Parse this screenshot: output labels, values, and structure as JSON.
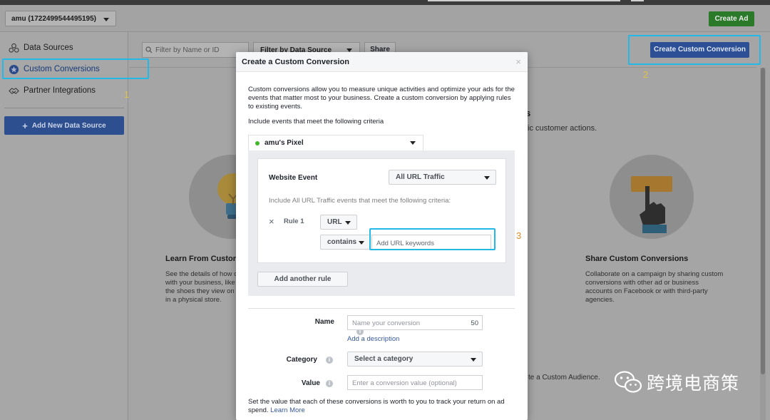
{
  "header": {
    "account_label": "amu (1722499544495195)",
    "create_ad_label": "Create Ad"
  },
  "sidebar": {
    "items": [
      {
        "label": "Data Sources",
        "icon": "data-sources-icon"
      },
      {
        "label": "Custom Conversions",
        "icon": "custom-conversions-icon"
      },
      {
        "label": "Partner Integrations",
        "icon": "partner-integrations-icon"
      }
    ],
    "add_source_label": "Add New Data Source"
  },
  "toolbar": {
    "filter_placeholder": "Filter by Name or ID",
    "data_source_label": "Filter by Data Source",
    "share_label": "Share",
    "create_custom_conversion_label": "Create Custom Conversion"
  },
  "annotations": {
    "one": "1",
    "two": "2",
    "three": "3",
    "highlight_color": "#22b8e8"
  },
  "background": {
    "fragment_s": "s",
    "customer_actions": "ic customer actions.",
    "learn_title": "Learn From Custom",
    "learn_desc": [
      "See the details of how c",
      "with your business, like",
      "the shoes they view on",
      "in a physical store."
    ],
    "share_title": "Share Custom Conversions",
    "share_desc": [
      "Collaborate on a campaign by sharing custom",
      "conversions with other ad or business",
      "accounts on Facebook or with third-party",
      "agencies."
    ],
    "audience_fragment": "te a Custom Audience."
  },
  "modal": {
    "title": "Create a Custom Conversion",
    "close_glyph": "×",
    "intro": "Custom conversions allow you to measure unique activities and optimize your ads for the events that matter most to your business. Create a custom conversion by applying rules to existing events.",
    "include_line": "Include events that meet the following criteria",
    "pixel_label": "amu's Pixel",
    "website_event_label": "Website Event",
    "website_event_value": "All URL Traffic",
    "criteria_line": "Include All URL Traffic events that meet the following criteria:",
    "rule_remove_glyph": "×",
    "rule_label": "Rule 1",
    "rule_field_value": "URL",
    "rule_operator_value": "contains",
    "url_keywords_placeholder": "Add URL keywords",
    "add_rule_label": "Add another rule",
    "info_glyph": "i",
    "name_label": "Name",
    "name_placeholder": "Name your conversion",
    "name_counter": "50",
    "add_description_label": "Add a description",
    "category_label": "Category",
    "category_value": "Select a category",
    "value_label": "Value",
    "value_placeholder": "Enter a conversion value (optional)",
    "footer_note": "Set the value that each of these conversions is worth to you to track your return on ad spend.",
    "learn_more_label": "Learn More"
  },
  "watermark": {
    "text": "跨境电商策",
    "icon": "wechat-icon"
  }
}
